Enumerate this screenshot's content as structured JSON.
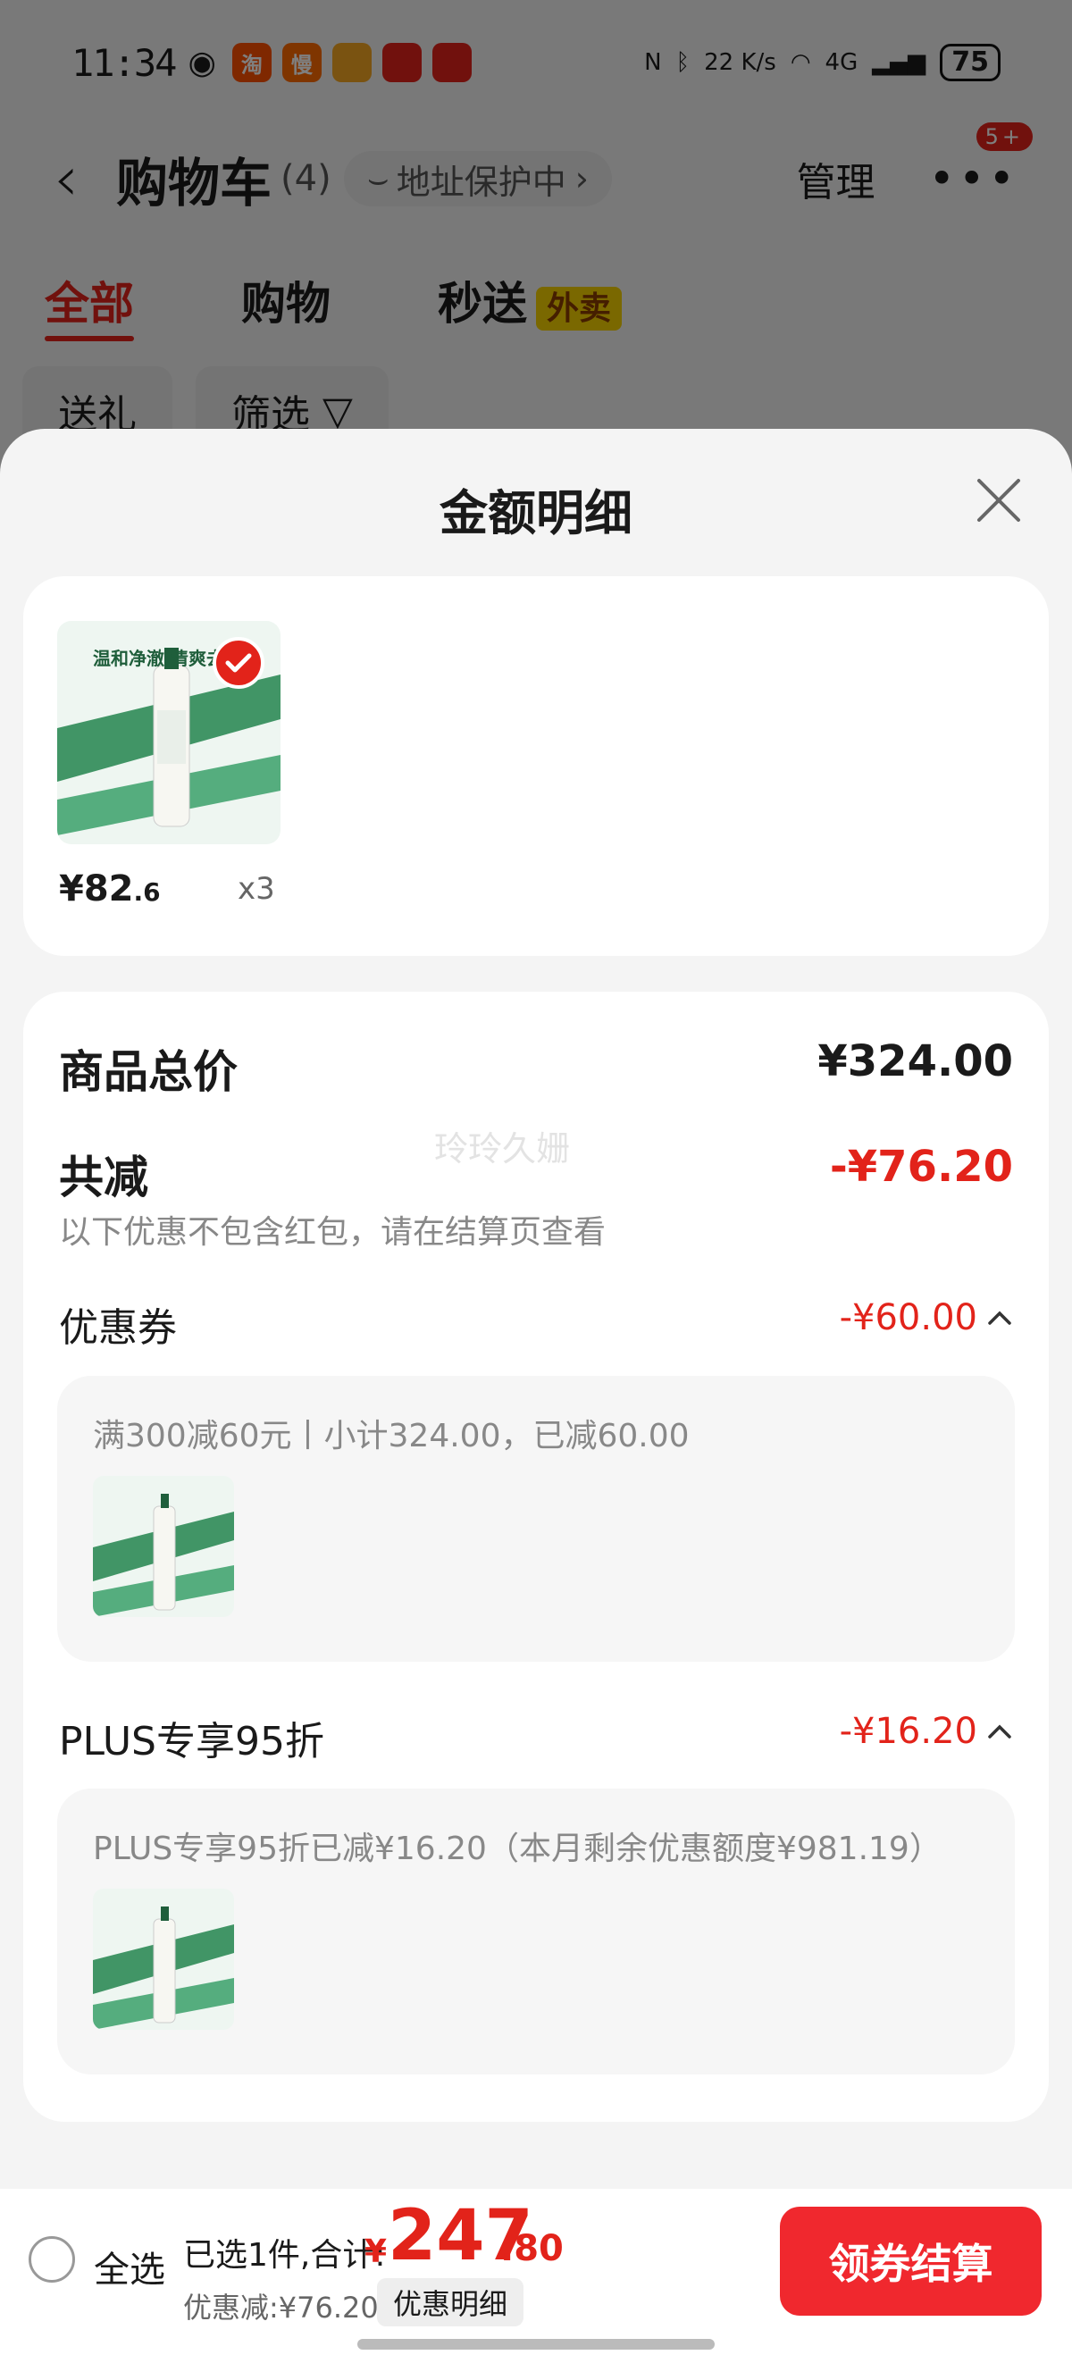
{
  "status_bar": {
    "time": "11:34",
    "apps": [
      {
        "label": "淘",
        "color": "#ff5000"
      },
      {
        "label": "慢",
        "color": "#ff6a00"
      },
      {
        "label": "",
        "color": "#f5a623"
      },
      {
        "label": "",
        "color": "#e2231a"
      },
      {
        "label": "",
        "color": "#e2231a"
      }
    ],
    "net_speed": "22 K/s",
    "network": "4G",
    "battery": "75"
  },
  "header": {
    "title": "购物车",
    "count": "(4)",
    "address_protect": "地址保护中",
    "manage": "管理",
    "more_badge": "5+"
  },
  "tabs": [
    {
      "label": "全部"
    },
    {
      "label": "购物"
    },
    {
      "label": "秒送"
    }
  ],
  "tab_badge": "外卖",
  "chips": [
    {
      "label": "送礼"
    },
    {
      "label": "筛选"
    }
  ],
  "sheet": {
    "title": "金额明细",
    "product": {
      "price_int": "¥82",
      "price_dec": ".6",
      "qty": "x3",
      "image_caption": "温和净澈 清爽去油"
    },
    "total_label": "商品总价",
    "total_value": "¥324.00",
    "reduce_label": "共减",
    "reduce_value": "-¥76.20",
    "reduce_note": "以下优惠不包含红包，请在结算页查看",
    "watermark": "玲玲久姗",
    "coupon_label": "优惠券",
    "coupon_value": "-¥60.00",
    "coupon_text": "满300减60元丨小计324.00，已减60.00",
    "plus_label": "PLUS专享95折",
    "plus_value": "-¥16.20",
    "plus_text": "PLUS专享95折已减¥16.20（本月剩余优惠额度¥981.19）"
  },
  "bottom_bar": {
    "select_all": "全选",
    "selected_text": "已选1件,合计:",
    "total_yen": "¥",
    "total_int": "247",
    "total_dec": ".80",
    "discount_text": "优惠减:¥76.20",
    "detail_button": "优惠明细",
    "checkout_button": "领券结算"
  },
  "colors": {
    "accent_red": "#e2231a",
    "product_green": "#2e8b57"
  }
}
